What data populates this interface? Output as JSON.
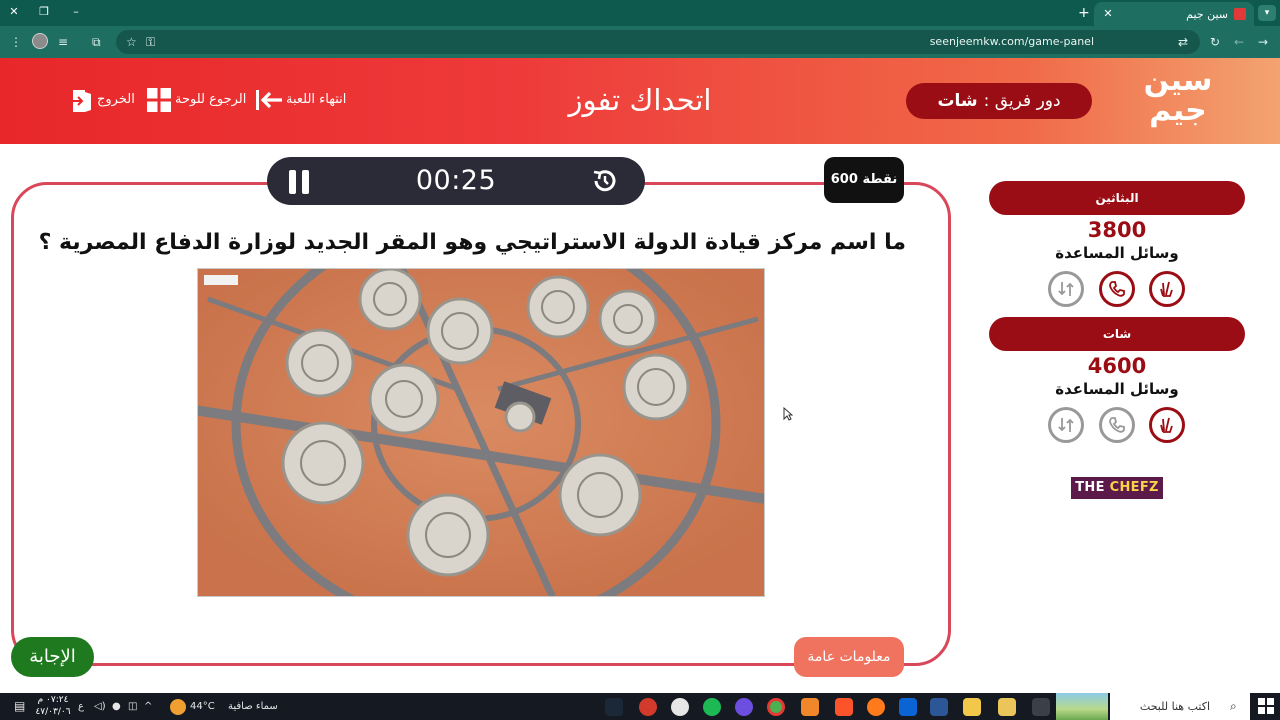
{
  "browser": {
    "tab_title": "سين جيم",
    "url": "seenjeemkw.com/game-panel",
    "tab_close": "✕",
    "tab_new": "+",
    "win_min": "–",
    "win_restore": "❐",
    "win_close": "✕"
  },
  "header": {
    "logo_line1": "سين",
    "logo_line2": "جيم",
    "turn_label": "دور فريق :",
    "turn_team": "شات",
    "challenge_title": "اتحداك تفوز",
    "end_game": "انتهاء اللعبة",
    "back_to_board": "الرجوع للوحة",
    "exit": "الخروج"
  },
  "question": {
    "timer": "00:25",
    "points": "600 نقطة",
    "text": "ما اسم مركز قيادة الدولة الاستراتيجي وهو المقر الجديد لوزارة الدفاع المصرية ؟",
    "image_caption": "",
    "answer_button": "الإجابة",
    "category": "معلومات عامة"
  },
  "teams": [
    {
      "name": "البثاثين",
      "score": "3800",
      "helps_label": "وسائل المساعدة",
      "helps": [
        {
          "icon": "two-answers-icon",
          "active": true
        },
        {
          "icon": "phone-icon",
          "active": true
        },
        {
          "icon": "swap-icon",
          "active": false
        }
      ]
    },
    {
      "name": "شات",
      "score": "4600",
      "helps_label": "وسائل المساعدة",
      "helps": [
        {
          "icon": "two-answers-icon",
          "active": true
        },
        {
          "icon": "phone-icon",
          "active": false
        },
        {
          "icon": "swap-icon",
          "active": false
        }
      ]
    }
  ],
  "sponsor": {
    "part1": "THE",
    "part2": "CHEFZ"
  },
  "taskbar": {
    "search_placeholder": "اكتب هنا للبحث",
    "weather_temp": "44°C",
    "weather_desc": "سماء صافية",
    "time": "٠٧:٢٤ م",
    "date": "٤٧/٠٣/٠٦",
    "lang": "ع"
  },
  "colors": {
    "header_red": "#e8272a",
    "dark_red": "#9b0d14",
    "answer_green": "#1f7a1f",
    "category_orange": "#f07360",
    "card_border": "#d8475a"
  }
}
